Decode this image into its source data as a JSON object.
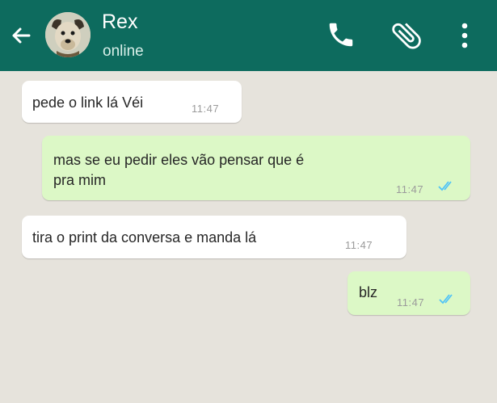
{
  "header": {
    "contact_name": "Rex",
    "status": "online",
    "icons": [
      "back-arrow-icon",
      "dog-avatar",
      "phone-icon",
      "paperclip-icon",
      "more-vert-icon"
    ],
    "colors": {
      "bar": "#0d6b5e",
      "incoming": "#ffffff",
      "outgoing": "#dcf8c6",
      "read_check": "#4fc3f7"
    }
  },
  "messages": [
    {
      "direction": "in",
      "text": "pede o link lá Véi",
      "time": "11:47"
    },
    {
      "direction": "out",
      "text_line1": "mas se eu pedir eles vão pensar que é",
      "text_line2": "pra mim",
      "time": "11:47",
      "read": true
    },
    {
      "direction": "in",
      "text": "tira o print da conversa e manda lá",
      "time": "11:47"
    },
    {
      "direction": "out",
      "text": "blz",
      "time": "11:47",
      "read": true
    }
  ]
}
